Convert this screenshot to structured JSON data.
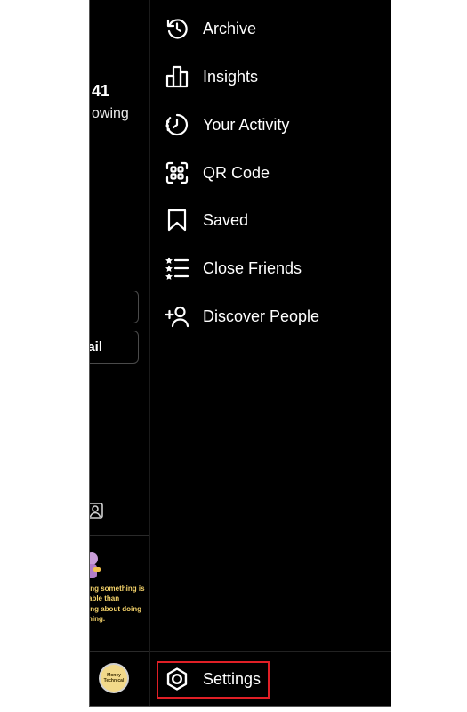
{
  "profile_panel": {
    "stat_number": "41",
    "stat_label": "owing",
    "button_2_label": "ail",
    "post_caption_lines": [
      "ing something is",
      "able than",
      "ing about doing",
      "hing."
    ],
    "avatar_text": "Money Technical"
  },
  "menu": {
    "items": [
      {
        "label": "Archive",
        "icon": "archive-icon"
      },
      {
        "label": "Insights",
        "icon": "insights-icon"
      },
      {
        "label": "Your Activity",
        "icon": "activity-icon"
      },
      {
        "label": "QR Code",
        "icon": "qr-code-icon"
      },
      {
        "label": "Saved",
        "icon": "bookmark-icon"
      },
      {
        "label": "Close Friends",
        "icon": "close-friends-icon"
      },
      {
        "label": "Discover People",
        "icon": "add-person-icon"
      }
    ],
    "settings": {
      "label": "Settings",
      "icon": "settings-gear-icon"
    }
  },
  "colors": {
    "background": "#000000",
    "text": "#ffffff",
    "highlight": "#e01f26"
  }
}
